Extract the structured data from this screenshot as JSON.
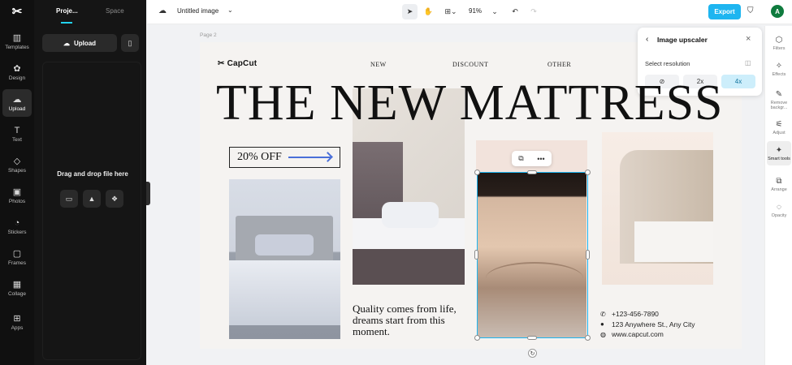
{
  "left_rail": {
    "items": [
      {
        "label": "Templates",
        "icon": "templates-icon",
        "glyph": "▥"
      },
      {
        "label": "Design",
        "icon": "design-icon",
        "glyph": "✿"
      },
      {
        "label": "Upload",
        "icon": "upload-cloud-icon",
        "glyph": "☁"
      },
      {
        "label": "Text",
        "icon": "text-icon",
        "glyph": "T"
      },
      {
        "label": "Shapes",
        "icon": "shapes-icon",
        "glyph": "◇"
      },
      {
        "label": "Photos",
        "icon": "photos-icon",
        "glyph": "▣"
      },
      {
        "label": "Stickers",
        "icon": "stickers-icon",
        "glyph": "◔"
      },
      {
        "label": "Frames",
        "icon": "frames-icon",
        "glyph": "▢"
      },
      {
        "label": "Collage",
        "icon": "collage-icon",
        "glyph": "▦"
      },
      {
        "label": "Apps",
        "icon": "apps-icon",
        "glyph": "⊞"
      }
    ],
    "active": "Upload"
  },
  "panel": {
    "tabs": [
      "Proje...",
      "Space"
    ],
    "upload_label": "Upload",
    "drop_text": "Drag and drop file here"
  },
  "topbar": {
    "title": "Untitled image",
    "zoom": "91%",
    "export_label": "Export",
    "avatar_letter": "A"
  },
  "canvas": {
    "page_label": "Page 2",
    "logo": "CapCut",
    "nav": [
      "NEW",
      "DISCOUNT",
      "OTHER"
    ],
    "headline": "THE NEW MATTRESS",
    "offer": "20% OFF",
    "quote": "Quality comes from life, dreams start from this moment.",
    "contact": [
      {
        "icon": "phone-icon",
        "glyph": "✆",
        "text": "+123-456-7890"
      },
      {
        "icon": "location-pin-icon",
        "glyph": "●",
        "text": "123 Anywhere St., Any City"
      },
      {
        "icon": "globe-icon",
        "glyph": "◍",
        "text": "www.capcut.com"
      }
    ]
  },
  "upscaler": {
    "title": "Image upscaler",
    "subtitle": "Select resolution",
    "options": [
      "⊘",
      "2x",
      "4x"
    ],
    "selected": "4x"
  },
  "right_rail": {
    "items": [
      {
        "label": "Filters",
        "glyph": "⬡"
      },
      {
        "label": "Effects",
        "glyph": "✧"
      },
      {
        "label": "Remove backgr...",
        "glyph": "✎"
      },
      {
        "label": "Adjust",
        "glyph": "⚟"
      },
      {
        "label": "Smart tools",
        "glyph": "✦"
      },
      {
        "label": "Arrange",
        "glyph": "⧉"
      },
      {
        "label": "Opacity",
        "glyph": "◌"
      }
    ],
    "active": "Smart tools"
  },
  "colors": {
    "accent": "#1eb5f0",
    "avatar": "#0f7b3e",
    "offer_arrow": "#4a6fd8"
  }
}
